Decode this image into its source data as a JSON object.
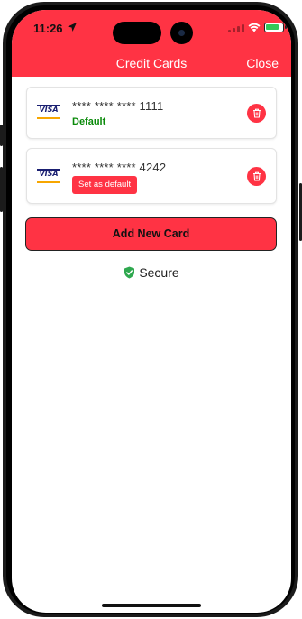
{
  "colors": {
    "accent": "#ff3344",
    "default_green": "#0a8a0a",
    "secure_green": "#2fa84f"
  },
  "status_bar": {
    "time": "11:26"
  },
  "header": {
    "title": "Credit Cards",
    "close_label": "Close"
  },
  "cards": [
    {
      "brand": "VISA",
      "number": "**** **** **** 1111",
      "default_label": "Default",
      "icon": "visa-icon",
      "action_icon": "trash-icon"
    },
    {
      "brand": "VISA",
      "number": "**** **** **** 4242",
      "set_default_label": "Set as default",
      "icon": "visa-icon",
      "action_icon": "trash-icon"
    }
  ],
  "add_card_label": "Add New Card",
  "secure": {
    "label": "Secure",
    "icon": "shield-check-icon"
  }
}
